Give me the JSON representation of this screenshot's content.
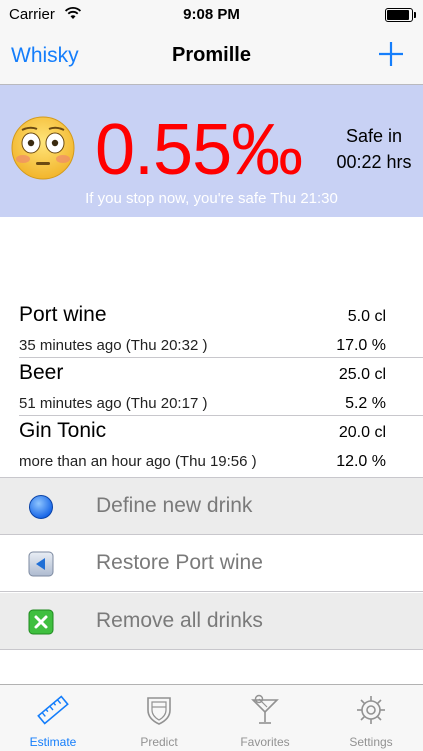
{
  "status_bar": {
    "carrier": "Carrier",
    "time": "9:08 PM"
  },
  "nav": {
    "back_label": "Whisky",
    "title": "Promille",
    "add_icon": "plus-icon"
  },
  "estimate": {
    "face_icon": "flushed-face-icon",
    "promille": "0.55‰",
    "safe_label": "Safe in",
    "safe_time": "00:22 hrs",
    "stop_note": "If you stop now, you're safe Thu 21:30",
    "accent_color": "#ff0000",
    "panel_color": "#c8d1f4"
  },
  "drinks": [
    {
      "name": "Port wine",
      "time": "35 minutes ago  (Thu 20:32 )",
      "volume": "5.0 cl",
      "percent": "17.0 %"
    },
    {
      "name": "Beer",
      "time": "51 minutes ago  (Thu 20:17 )",
      "volume": "25.0 cl",
      "percent": "5.2 %"
    },
    {
      "name": "Gin Tonic",
      "time": "more than an hour ago  (Thu 19:56 )",
      "volume": "20.0 cl",
      "percent": "12.0 %"
    }
  ],
  "actions": [
    {
      "label": "Define new drink",
      "icon": "blue-circle-icon"
    },
    {
      "label": "Restore Port wine",
      "icon": "back-arrow-icon"
    },
    {
      "label": "Remove all drinks",
      "icon": "green-x-icon"
    }
  ],
  "tabs": [
    {
      "label": "Estimate",
      "icon": "ruler-icon",
      "active": true
    },
    {
      "label": "Predict",
      "icon": "shield-icon",
      "active": false
    },
    {
      "label": "Favorites",
      "icon": "cocktail-glass-icon",
      "active": false
    },
    {
      "label": "Settings",
      "icon": "gear-icon",
      "active": false
    }
  ]
}
